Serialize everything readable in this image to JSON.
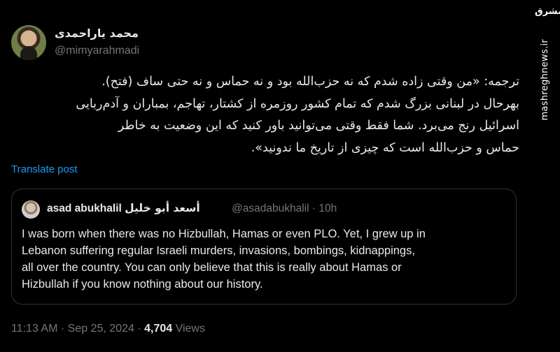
{
  "author": {
    "display_name": "محمد یاراحمدی",
    "handle": "@mimyarahmadi"
  },
  "post": {
    "text_lines": [
      "ترجمه: «من وقتی زاده شدم که نه حزب‌الله بود و نه حماس و نه حتی ساف (فتح).",
      "بهرحال در لبنانی بزرگ شدم که تمام کشور روزمره از کشتار، تهاجم، بمباران و آدم‌ربایی",
      "اسرائیل رنج می‌برد. شما فقط وقتی می‌توانید باور کنید که این وضعیت به خاطر",
      "حماس و حزب‌الله است که چیزی از تاریخ ما ندونید»."
    ],
    "translate_label": "Translate post"
  },
  "quoted_post": {
    "name_latin": "asad abukhalil",
    "name_arabic": "أسعد أبو خليل",
    "handle": "@asadabukhalil",
    "separator": "·",
    "age": "10h",
    "text_lines": [
      "I was born when there was no Hizbullah, Hamas or even PLO. Yet, I grew up in",
      "Lebanon suffering regular Israeli murders, invasions, bombings, kidnappings,",
      "all over the country. You can only believe that this is really about Hamas or",
      "Hizbullah if you know nothing about our history."
    ]
  },
  "footer": {
    "time": "11:13 AM",
    "date": "Sep 25, 2024",
    "separator": "·",
    "views_count": "4,704",
    "views_label": "Views"
  },
  "watermark": {
    "logo_text": "مشرق",
    "site_text": "mashreghnews.ir"
  },
  "colors": {
    "background": "#000000",
    "text": "#e7e9ea",
    "muted": "#71767b",
    "link": "#1d9bf0",
    "border": "#2f3336"
  }
}
